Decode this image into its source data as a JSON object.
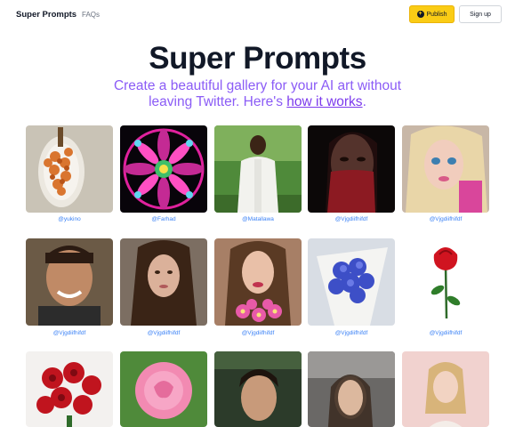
{
  "nav": {
    "brand": "Super Prompts",
    "faqs": "FAQs",
    "publish": "Publish",
    "publish_icon": "plus-circle-icon",
    "signup": "Sign up"
  },
  "hero": {
    "title": "Super Prompts",
    "subtitle_line1": "Create a beautiful gallery for your AI art without",
    "subtitle_pre": "leaving Twitter. Here's ",
    "subtitle_link": "how it works",
    "subtitle_post": "."
  },
  "gallery": {
    "handles": [
      "@yukino",
      "@Farhad",
      "@Matallawa",
      "@Vjgdiifhifdf",
      "@Vjgdiifhifdf",
      "@Vjgdiifhifdf",
      "@Vjgdiifhifdf",
      "@Vjgdiifhifdf",
      "@Vjgdiifhifdf",
      "@Vjgdiifhifdf"
    ]
  },
  "colors": {
    "accent": "#8b5cf6",
    "publish_bg": "#facc15",
    "handle": "#3b82f6"
  }
}
